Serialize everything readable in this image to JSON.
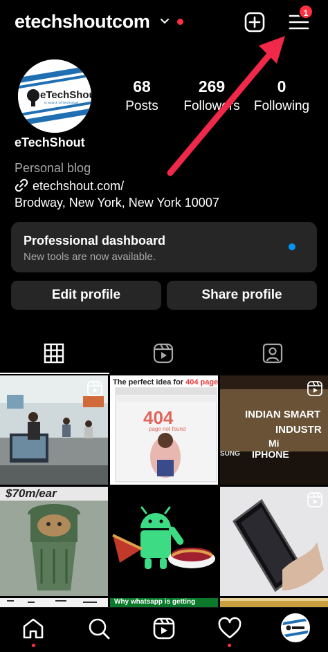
{
  "header": {
    "username": "etechshoutcom",
    "menu_badge": "1"
  },
  "profile": {
    "avatar_label": "eTechShout",
    "avatar_tagline": "In Search Of Technology",
    "display_name": "eTechShout",
    "category": "Personal blog",
    "link": "etechshout.com/",
    "address": "Brodway, New York, New York 10007"
  },
  "stats": [
    {
      "value": "68",
      "label": "Posts"
    },
    {
      "value": "269",
      "label": "Followers"
    },
    {
      "value": "0",
      "label": "Following"
    }
  ],
  "dashboard": {
    "title": "Professional dashboard",
    "subtitle": "New tools are now available."
  },
  "actions": {
    "edit": "Edit profile",
    "share": "Share profile"
  },
  "posts": {
    "p2_headline_pre": "The perfect idea for ",
    "p2_headline_hl": "404 page",
    "p2_code": "404",
    "p2_sub": "page not found",
    "p3_line1": "INDIAN SMART",
    "p3_line2": "INDUSTR",
    "p3_line3": "Mi",
    "p3_line4": "IPHONE",
    "p3_line5": "SUNG",
    "p4_text": "$70m/ear",
    "p8_text": "Why whatsapp is getting"
  },
  "colors": {
    "accent_blue": "#0095f6",
    "notification_red": "#ff3040",
    "arrow_red": "#f0284a",
    "surface": "#262626"
  }
}
